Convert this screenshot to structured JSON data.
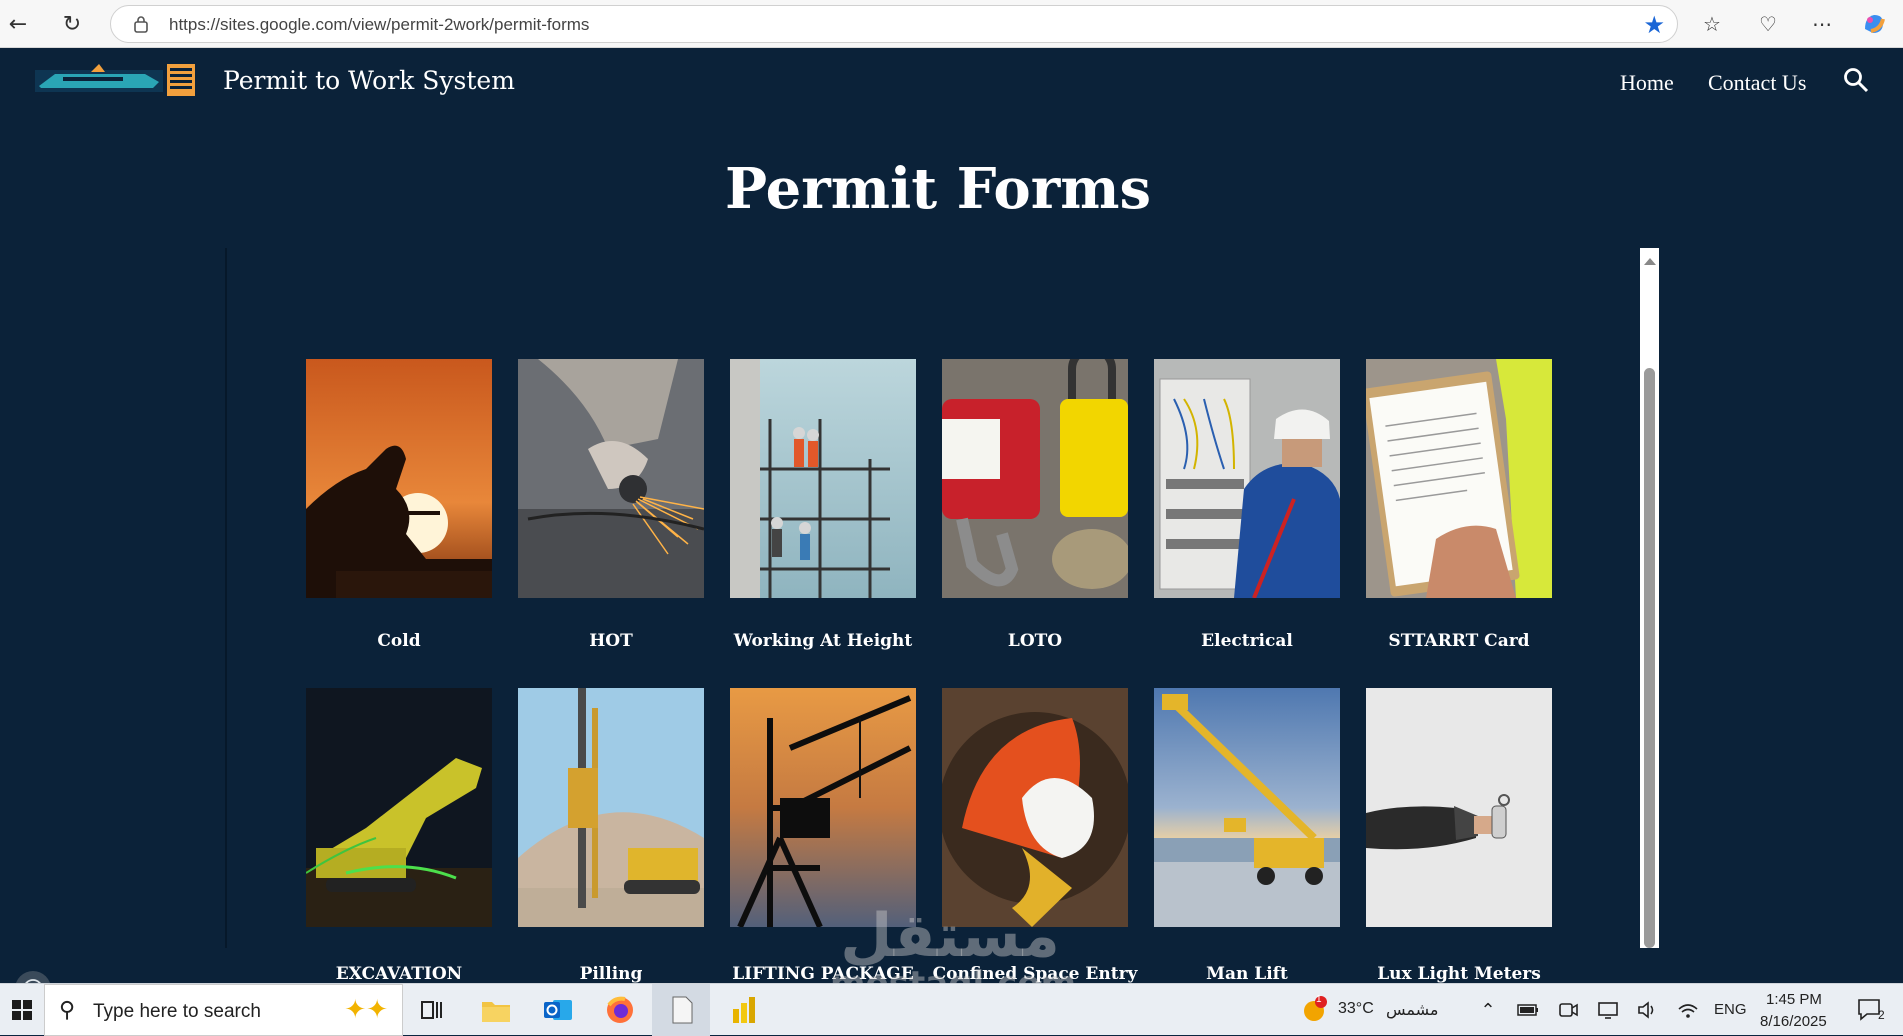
{
  "browser": {
    "url": "https://sites.google.com/view/permit-2work/permit-forms"
  },
  "site": {
    "title": "Permit to Work System",
    "nav": [
      "Home",
      "Contact Us"
    ]
  },
  "page": {
    "title": "Permit Forms"
  },
  "cards_row1": [
    {
      "label": "Cold"
    },
    {
      "label": "HOT"
    },
    {
      "label": "Working At Height"
    },
    {
      "label": "LOTO"
    },
    {
      "label": "Electrical"
    },
    {
      "label": "STTARRT Card"
    }
  ],
  "cards_row2": [
    {
      "label": "EXCAVATION"
    },
    {
      "label": "Pilling"
    },
    {
      "label": "LIFTING PACKAGE"
    },
    {
      "label": "Confined Space Entry"
    },
    {
      "label": "Man Lift"
    },
    {
      "label": "Lux Light Meters"
    }
  ],
  "watermark": {
    "arabic": "مستقل",
    "latin": "mostaql.com"
  },
  "taskbar": {
    "search_placeholder": "Type here to search",
    "weather_temp": "33°C",
    "weather_desc": "مشمس",
    "weather_badge": "1",
    "language": "ENG",
    "time": "1:45 PM",
    "date": "8/16/2025",
    "notification_count": "2"
  }
}
